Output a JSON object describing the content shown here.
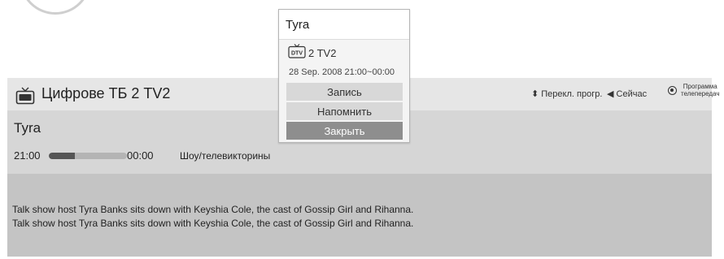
{
  "header": {
    "channel_title": "Цифрове ТБ 2  TV2",
    "hints": {
      "switch": "⬍ Перекл. прогр.",
      "now": "◀ Сейчас",
      "guide_line1": "Программа",
      "guide_line2": "телепередач"
    }
  },
  "program": {
    "title": "Tyra",
    "start_time": "21:00",
    "end_time": "00:00",
    "progress": 0.33,
    "genre": "Шоу/телевикторины"
  },
  "description": {
    "line1": "Talk show host Tyra Banks sits down with Keyshia Cole, the cast of Gossip Girl and Rihanna.",
    "line2": "Talk show host Tyra Banks sits down with Keyshia Cole, the cast of Gossip Girl and Rihanna."
  },
  "popup": {
    "title": "Tyra",
    "dtv_label": "DTV",
    "channel": "2 TV2",
    "datetime": "28 Sep. 2008 21:00~00:00",
    "buttons": {
      "record": "Запись",
      "remind": "Напомнить",
      "close": "Закрыть"
    }
  },
  "colors": {
    "header_bg": "#e6e6e6",
    "info_bg": "#d6d6d6",
    "desc_bg": "#c4c4c4",
    "close_btn": "#8e8e8e"
  }
}
